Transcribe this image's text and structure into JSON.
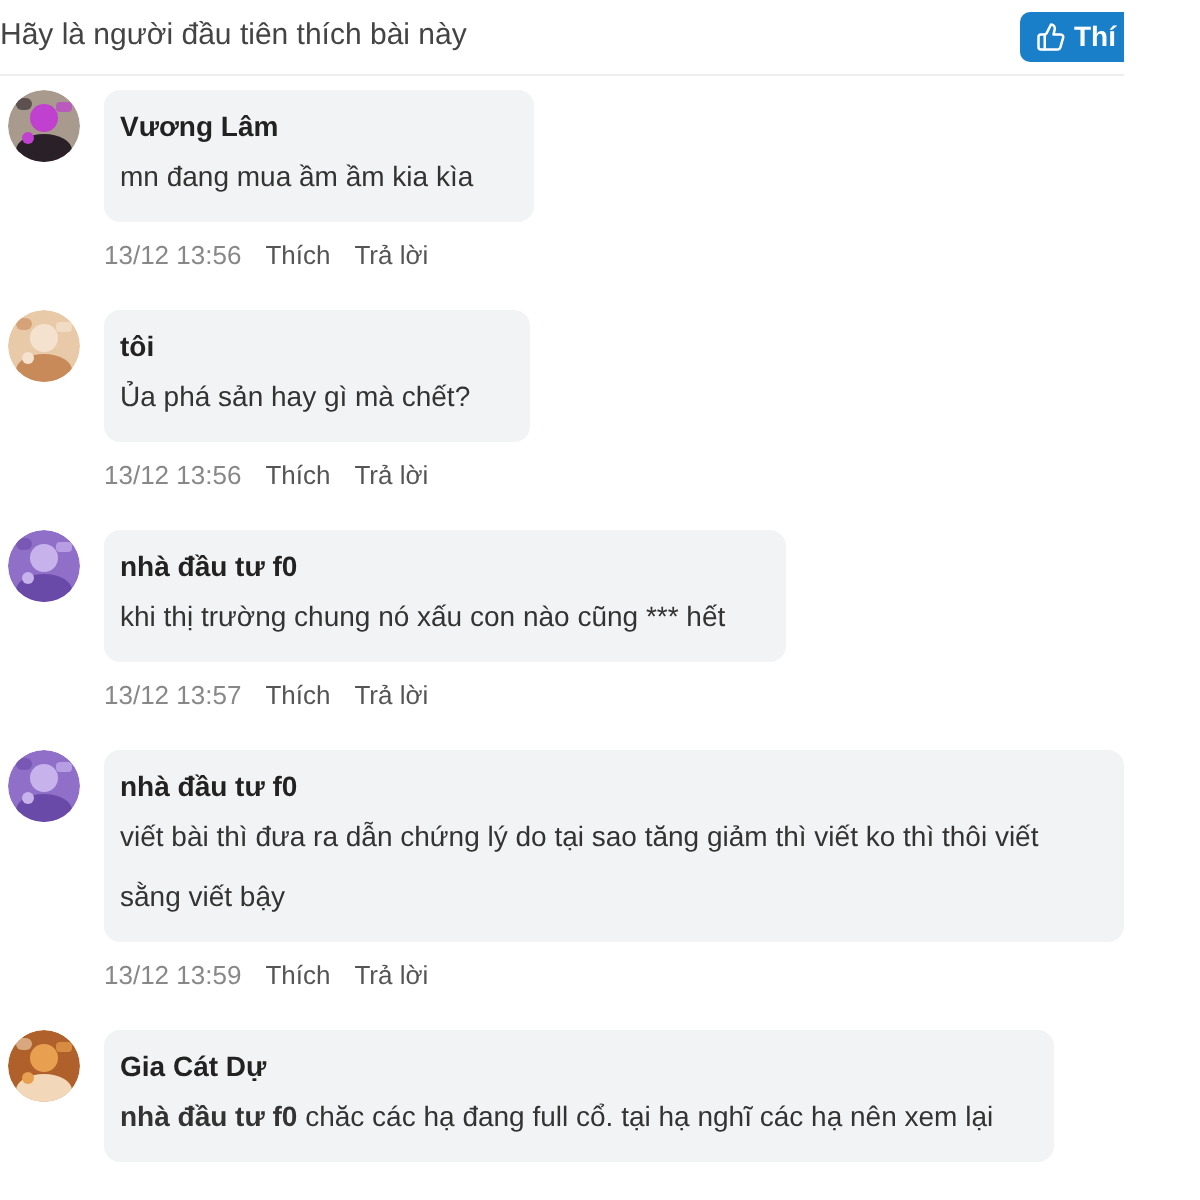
{
  "header": {
    "prompt": "Hãy là người đầu tiên thích bài này",
    "like_button": "Thí"
  },
  "comments": [
    {
      "author": "Vương Lâm",
      "text": "mn đang mua ầm ầm kia kìa",
      "time": "13/12 13:56",
      "like": "Thích",
      "reply": "Trả lời"
    },
    {
      "author": "tôi",
      "text": "Ủa phá sản hay gì mà chết?",
      "time": "13/12 13:56",
      "like": "Thích",
      "reply": "Trả lời"
    },
    {
      "author": "nhà đầu tư f0",
      "text": "khi thị trường chung nó xấu con nào cũng *** hết",
      "time": "13/12 13:57",
      "like": "Thích",
      "reply": "Trả lời"
    },
    {
      "author": "nhà đầu tư f0",
      "text": "viết bài thì đưa ra dẫn chứng lý do tại sao tăng giảm thì viết ko thì thôi viết sằng viết bậy",
      "time": "13/12 13:59",
      "like": "Thích",
      "reply": "Trả lời"
    },
    {
      "author": "Gia Cát Dự",
      "text": "**nhà đầu tư f0** chăc các hạ đang full cổ. tại hạ nghĩ các hạ nên xem lại"
    }
  ]
}
